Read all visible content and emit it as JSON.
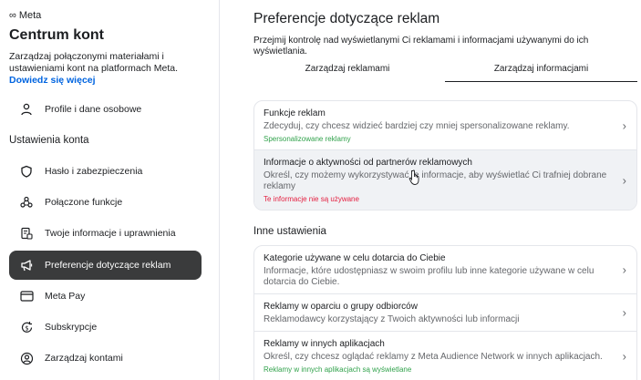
{
  "sidebar": {
    "brand_logo": "∞",
    "brand": "Meta",
    "title": "Centrum kont",
    "description": "Zarządzaj połączonymi materiałami i ustawieniami kont na platformach Meta.",
    "learn_more": "Dowiedz się więcej",
    "section_label": "Ustawienia konta",
    "items": [
      {
        "label": "Profile i dane osobowe",
        "icon": "person-icon"
      },
      {
        "label": "Hasło i zabezpieczenia",
        "icon": "shield-icon"
      },
      {
        "label": "Połączone funkcje",
        "icon": "connected-people-icon"
      },
      {
        "label": "Twoje informacje i uprawnienia",
        "icon": "info-document-icon"
      },
      {
        "label": "Preferencje dotyczące reklam",
        "icon": "megaphone-icon",
        "active": true
      },
      {
        "label": "Meta Pay",
        "icon": "credit-card-icon"
      },
      {
        "label": "Subskrypcje",
        "icon": "subscription-icon"
      },
      {
        "label": "Zarządzaj kontami",
        "icon": "account-circle-icon"
      }
    ]
  },
  "main": {
    "title": "Preferencje dotyczące reklam",
    "subtitle": "Przejmij kontrolę nad wyświetlanymi Ci reklamami i informacjami używanymi do ich wyświetlania.",
    "tabs": [
      {
        "label": "Zarządzaj reklamami",
        "selected": false
      },
      {
        "label": "Zarządzaj informacjami",
        "selected": true
      }
    ],
    "card1": [
      {
        "title": "Funkcje reklam",
        "desc": "Zdecyduj, czy chcesz widzieć bardziej czy mniej spersonalizowane reklamy.",
        "status": "Spersonalizowane reklamy"
      },
      {
        "title": "Informacje o aktywności od partnerów reklamowych",
        "desc": "Określ, czy możemy wykorzystywać te informacje, aby wyświetlać Ci trafniej dobrane reklamy",
        "status": "Te informacje nie są używane"
      }
    ],
    "other_title": "Inne ustawienia",
    "card2": [
      {
        "title": "Kategorie używane w celu dotarcia do Ciebie",
        "desc": "Informacje, które udostępniasz w swoim profilu lub inne kategorie używane w celu dotarcia do Ciebie."
      },
      {
        "title": "Reklamy w oparciu o grupy odbiorców",
        "desc": "Reklamodawcy korzystający z Twoich aktywności lub informacji"
      },
      {
        "title": "Reklamy w innych aplikacjach",
        "desc": "Określ, czy chcesz oglądać reklamy z Meta Audience Network w innych aplikacjach.",
        "status": "Reklamy w innych aplikacjach są wyświetlane"
      }
    ],
    "chevron": "›"
  },
  "colors": {
    "accent_link": "#0064e0",
    "active_nav_bg": "#3a3b3c",
    "status_green": "#31a24c",
    "status_red": "#e41e3f"
  }
}
